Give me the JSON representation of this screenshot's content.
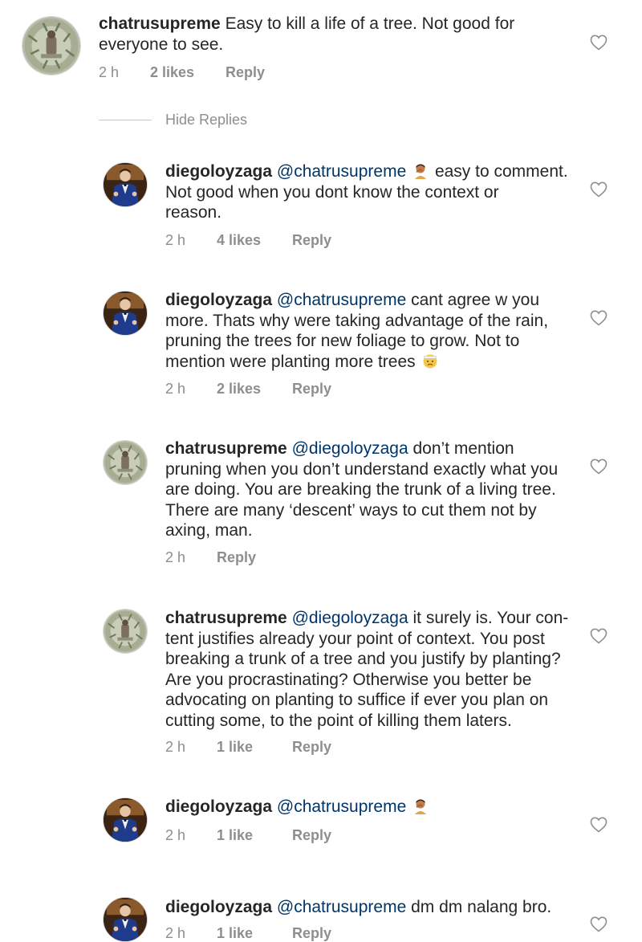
{
  "hide_replies_label": "Hide Replies",
  "icons": {
    "like": "heart-outline-icon",
    "emoji_person": "person-facepalming-emoji",
    "emoji_face": "face-with-head-bandage-emoji"
  },
  "colors": {
    "username": "#262626",
    "mention": "#003569",
    "meta": "#8e8e8e",
    "heart": "#8e8e8e"
  },
  "comments": [
    {
      "avatar": "chatrusupreme-avatar",
      "username": "chatrusupreme",
      "text": "Easy to kill a life of a tree. Not good for",
      "text2": "everyone to see.",
      "time": "2 h",
      "likes": "2 likes",
      "reply": "Reply"
    },
    {
      "avatar": "diegoloyzaga-avatar",
      "username": "diegoloyzaga",
      "mention": "@chatrusupreme",
      "text": "easy to comment.",
      "text2": "Not good when you dont know the context or",
      "text3": "reason.",
      "time": "2 h",
      "likes": "4 likes",
      "reply": "Reply"
    },
    {
      "avatar": "diegoloyzaga-avatar",
      "username": "diegoloyzaga",
      "mention": "@chatrusupreme",
      "text": "cant agree w you",
      "text2": "more. Thats why were taking advantage of the rain,",
      "text3": "pruning the trees for new foliage to grow. Not to",
      "text4": "mention were planting more trees",
      "time": "2 h",
      "likes": "2 likes",
      "reply": "Reply"
    },
    {
      "avatar": "chatrusupreme-avatar",
      "username": "chatrusupreme",
      "mention": "@diegoloyzaga",
      "text": "don’t mention",
      "text2": "pruning when you don’t understand exactly what you",
      "text3": "are doing. You are breaking the trunk of a living tree.",
      "text4": "There are many ‘descent’ ways to cut them not by",
      "text5": "axing, man.",
      "time": "2 h",
      "reply": "Reply"
    },
    {
      "avatar": "chatrusupreme-avatar",
      "username": "chatrusupreme",
      "mention": "@diegoloyzaga",
      "text": "it surely is. Your con-",
      "text2": "tent justifies already your point of context. You post",
      "text3": "breaking a trunk of a tree and you justify by planting?",
      "text4": "Are you procrastinating? Otherwise you better be",
      "text5": "advocating on planting to suffice if ever you plan on",
      "text6": "cutting some, to the point of killing them laters.",
      "time": "2 h",
      "likes": "1 like",
      "reply": "Reply"
    },
    {
      "avatar": "diegoloyzaga-avatar",
      "username": "diegoloyzaga",
      "mention": "@chatrusupreme",
      "time": "2 h",
      "likes": "1 like",
      "reply": "Reply"
    },
    {
      "avatar": "diegoloyzaga-avatar",
      "username": "diegoloyzaga",
      "mention": "@chatrusupreme",
      "text": "dm dm nalang bro.",
      "time": "2 h",
      "likes": "1 like",
      "reply": "Reply"
    }
  ]
}
